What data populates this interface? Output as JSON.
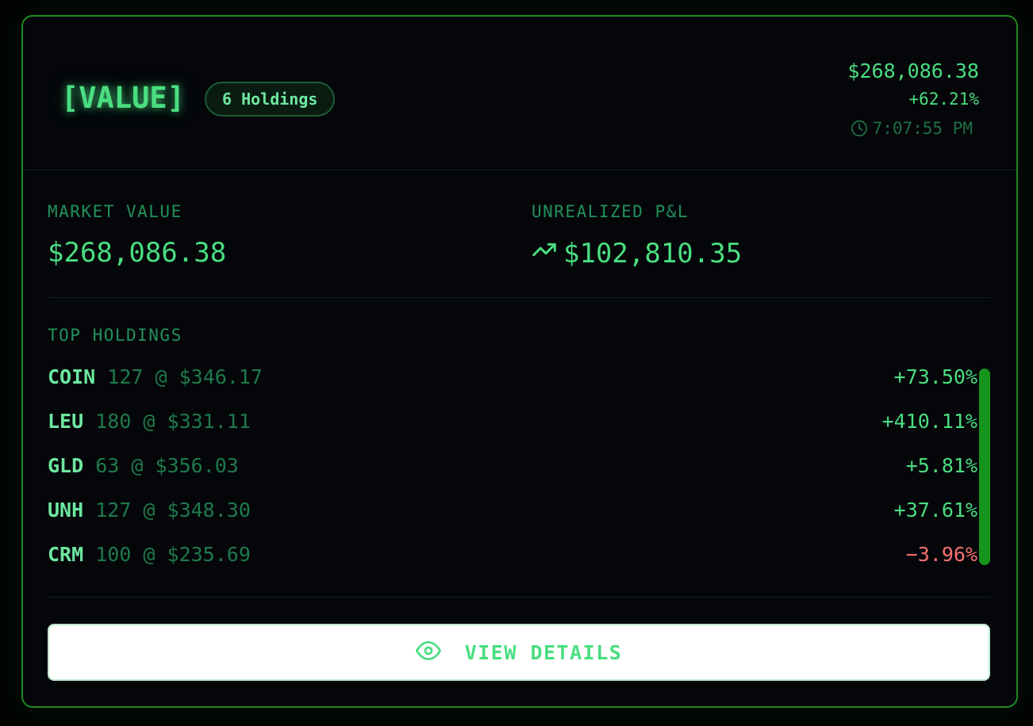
{
  "header": {
    "title": "[VALUE]",
    "badge": "6 Holdings",
    "total_value": "$268,086.38",
    "total_change": "+62.21%",
    "time": "7:07:55 PM"
  },
  "metrics": {
    "market_value_label": "MARKET VALUE",
    "market_value": "$268,086.38",
    "pnl_label": "UNREALIZED P&L",
    "pnl_value": "$102,810.35"
  },
  "holdings": {
    "label": "TOP HOLDINGS",
    "items": [
      {
        "symbol": "COIN",
        "position": "127 @ $346.17",
        "change": "+73.50%"
      },
      {
        "symbol": "LEU",
        "position": "180 @ $331.11",
        "change": "+410.11%"
      },
      {
        "symbol": "GLD",
        "position": "63 @ $356.03",
        "change": "+5.81%"
      },
      {
        "symbol": "UNH",
        "position": "127 @ $348.30",
        "change": "+37.61%"
      },
      {
        "symbol": "CRM",
        "position": "100 @ $235.69",
        "change": "−3.96%"
      }
    ]
  },
  "actions": {
    "view_details": "VIEW DETAILS"
  },
  "icons": {
    "time": "clock-icon",
    "pnl": "trending-up-icon",
    "view": "eye-icon"
  },
  "colors": {
    "accent": "#4ade80",
    "border": "#1f8a1f",
    "loss": "#f87171",
    "background": "#04060a"
  }
}
